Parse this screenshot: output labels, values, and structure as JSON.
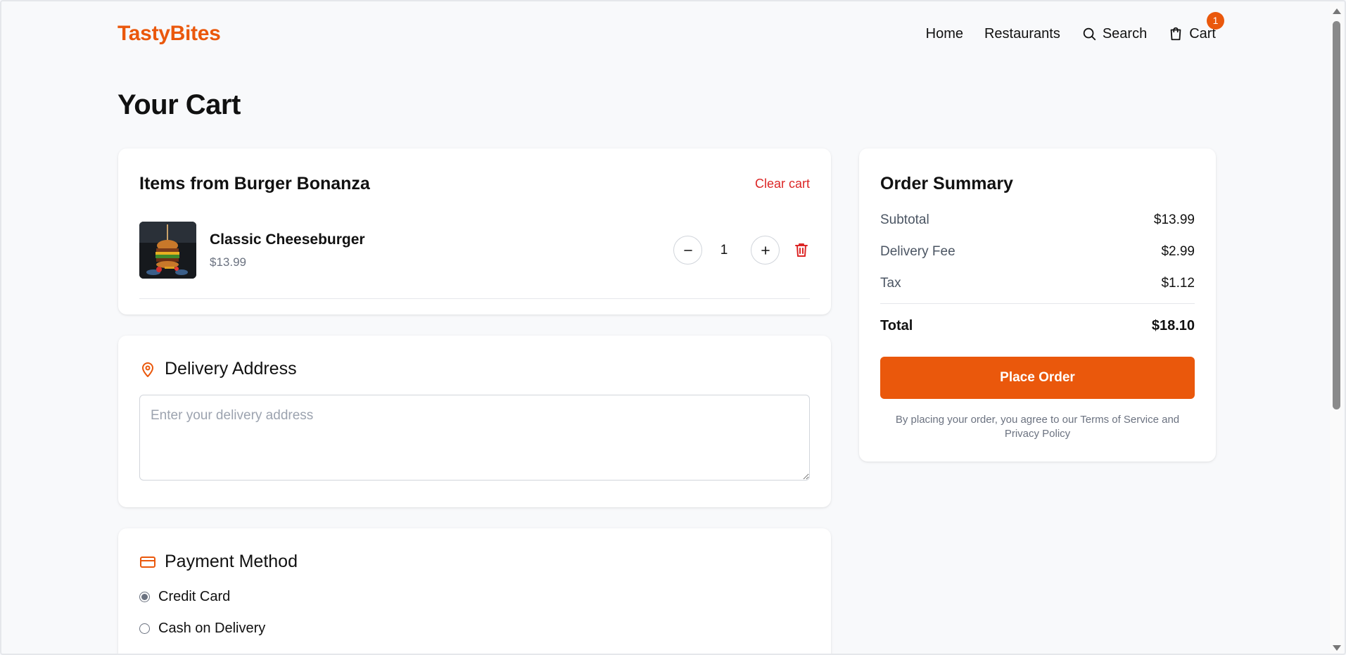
{
  "header": {
    "logo": "TastyBites",
    "nav": {
      "home": "Home",
      "restaurants": "Restaurants",
      "search": "Search",
      "cart": "Cart",
      "cart_count": "1"
    }
  },
  "page_title": "Your Cart",
  "cart": {
    "title": "Items from Burger Bonanza",
    "clear_label": "Clear cart",
    "items": [
      {
        "name": "Classic Cheeseburger",
        "price": "$13.99",
        "quantity": "1"
      }
    ]
  },
  "delivery": {
    "title": "Delivery Address",
    "placeholder": "Enter your delivery address",
    "value": ""
  },
  "payment": {
    "title": "Payment Method",
    "options": [
      {
        "label": "Credit Card",
        "selected": true
      },
      {
        "label": "Cash on Delivery",
        "selected": false
      }
    ]
  },
  "summary": {
    "title": "Order Summary",
    "subtotal_label": "Subtotal",
    "subtotal": "$13.99",
    "delivery_label": "Delivery Fee",
    "delivery": "$2.99",
    "tax_label": "Tax",
    "tax": "$1.12",
    "total_label": "Total",
    "total": "$18.10",
    "place_order_label": "Place Order",
    "terms": "By placing your order, you agree to our Terms of Service and Privacy Policy"
  },
  "colors": {
    "accent": "#ea580c",
    "danger": "#dc2626",
    "background": "#f8f9fb"
  },
  "icons": {
    "search": "search-icon",
    "cart": "shopping-bag-icon",
    "minus": "minus-icon",
    "plus": "plus-icon",
    "trash": "trash-icon",
    "location": "map-pin-icon",
    "card": "credit-card-icon"
  }
}
